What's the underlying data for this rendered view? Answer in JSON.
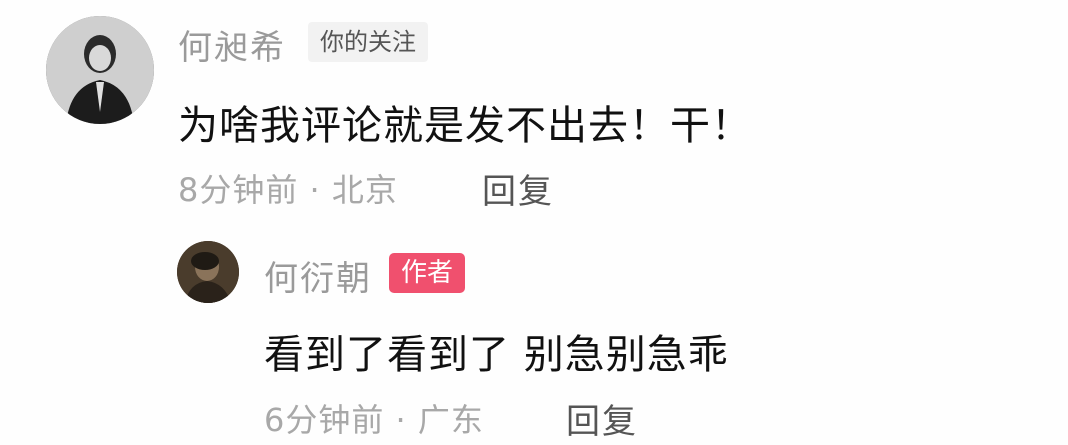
{
  "comment": {
    "username": "何昶希",
    "relation_tag": "你的关注",
    "text": "为啥我评论就是发不出去！干！",
    "meta": "8分钟前 · 北京",
    "reply_label": "回复",
    "reply": {
      "username": "何衍朝",
      "role_tag": "作者",
      "text": "看到了看到了 别急别急乖",
      "meta": "6分钟前 · 广东",
      "reply_label": "回复"
    }
  },
  "colors": {
    "username": "#9a9a9a",
    "text": "#111111",
    "meta": "#a8a8a8",
    "author_tag_bg": "#f0506e",
    "follow_tag_bg": "#f2f2f2"
  }
}
